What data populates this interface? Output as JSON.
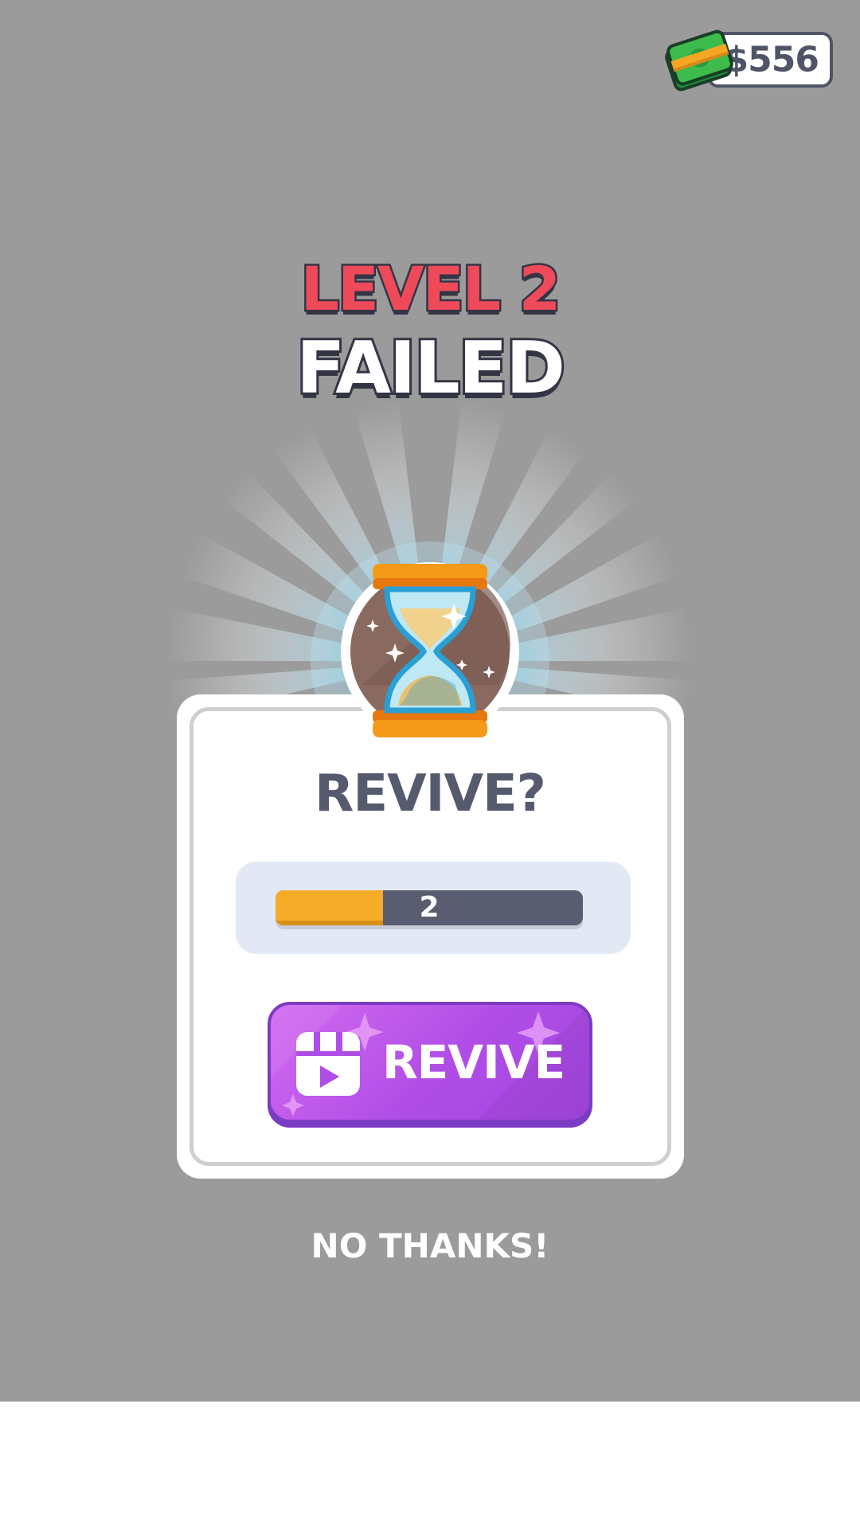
{
  "currency": {
    "value": "$556",
    "icon": "cash-stack-icon"
  },
  "title": {
    "level": "LEVEL 2",
    "status": "FAILED"
  },
  "dialog": {
    "question": "REVIVE?",
    "timer": {
      "count": "2",
      "progress_fraction": 0.35
    },
    "revive_button": {
      "label": "REVIVE",
      "icon": "video-ad-icon"
    },
    "hero_icon": "hourglass-icon"
  },
  "footer": {
    "no_thanks": "NO THANKS!"
  },
  "colors": {
    "background": "#9b9b9b",
    "level_red": "#ef4a5a",
    "button_purple": "#b04de6",
    "timer_orange": "#f5ac29",
    "timer_track": "#5a5d6f",
    "text_dark": "#555a6e"
  }
}
